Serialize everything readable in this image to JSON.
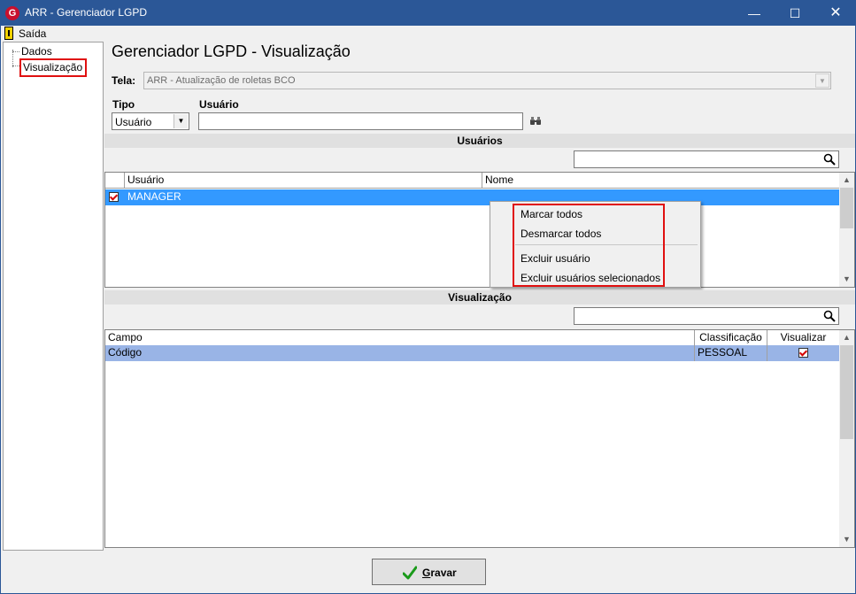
{
  "window": {
    "title": "ARR - Gerenciador LGPD",
    "icon_letter": "G"
  },
  "menu": {
    "exit_label": "Saída"
  },
  "sidebar": {
    "items": [
      {
        "label": "Dados"
      },
      {
        "label": "Visualização",
        "selected": true
      }
    ]
  },
  "page": {
    "title": "Gerenciador LGPD - Visualização"
  },
  "form": {
    "tela_label": "Tela:",
    "tela_value": "ARR - Atualização de roletas BCO",
    "tipo_label": "Tipo",
    "tipo_value": "Usuário",
    "usuario_label": "Usuário",
    "usuario_value": ""
  },
  "usuarios_section": {
    "title": "Usuários",
    "search_value": "",
    "columns": [
      "Usuário",
      "Nome"
    ],
    "rows": [
      {
        "checked": true,
        "usuario": "MANAGER",
        "nome": ""
      }
    ]
  },
  "context_menu": {
    "items": [
      "Marcar todos",
      "Desmarcar todos",
      "Excluir usuário",
      "Excluir usuários selecionados"
    ]
  },
  "visualizacao_section": {
    "title": "Visualização",
    "search_value": "",
    "columns": [
      "Campo",
      "Classificação",
      "Visualizar"
    ],
    "rows": [
      {
        "campo": "Código",
        "classificacao": "PESSOAL",
        "visualizar": true
      }
    ]
  },
  "footer": {
    "save_label": "Gravar",
    "save_mnemonic": "G"
  },
  "colors": {
    "titlebar": "#2b5797",
    "selection": "#3399ff",
    "row_highlight": "#99b4e6",
    "highlight_box": "#e01010"
  }
}
